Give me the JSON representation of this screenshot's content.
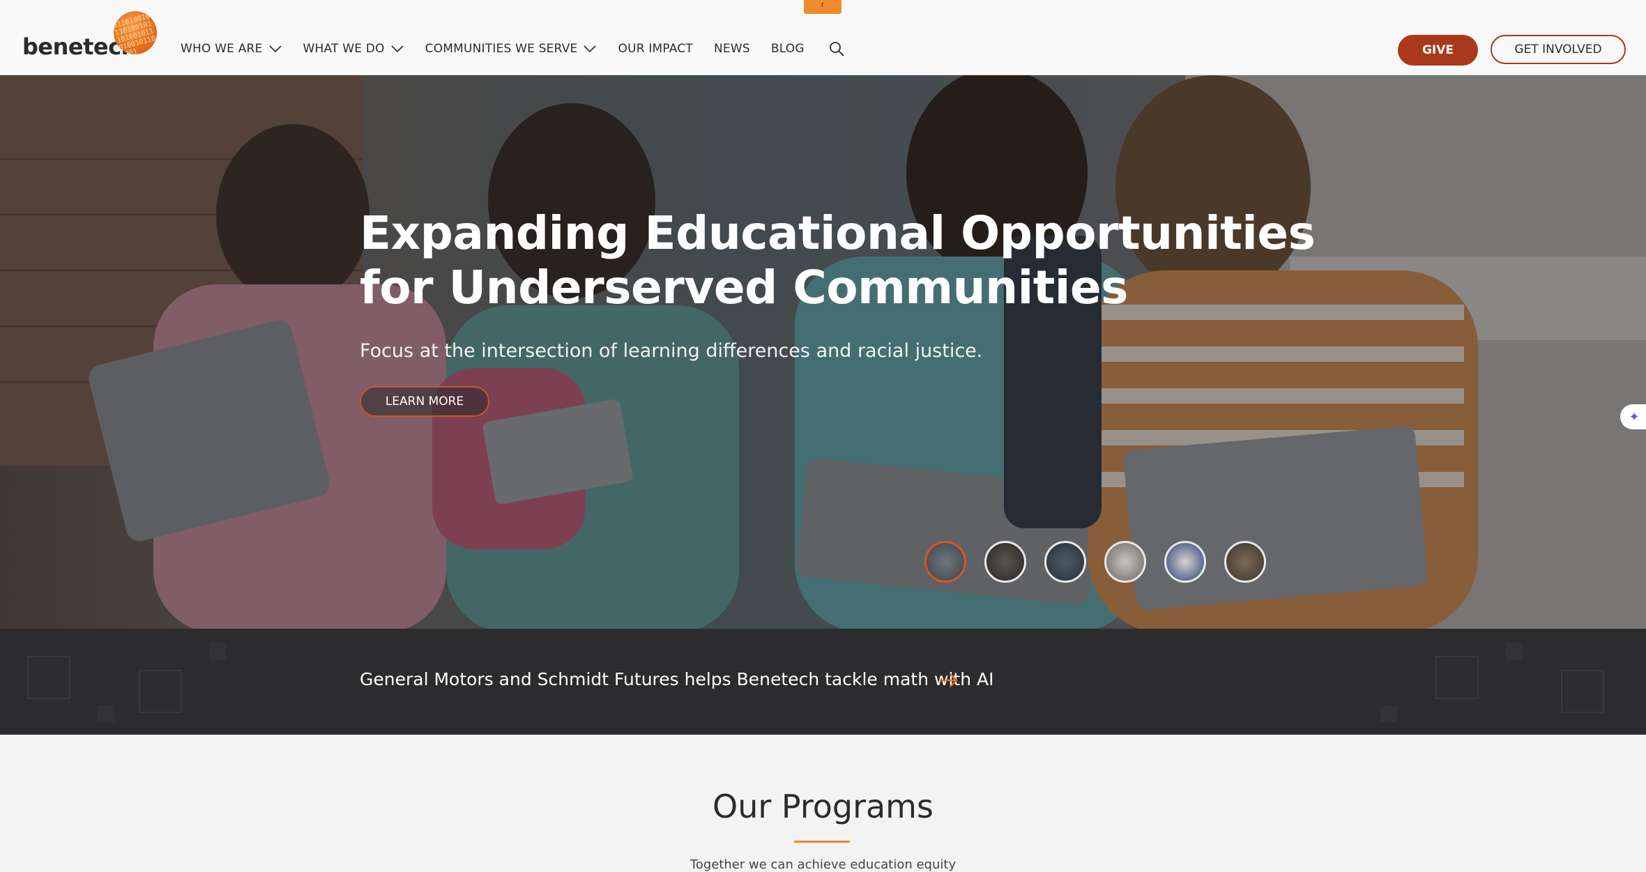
{
  "header": {
    "logo_text": "benetech",
    "logo_binary": "0110100101101001011010010110100101101001",
    "nav": [
      {
        "label": "WHO WE ARE",
        "has_dropdown": true
      },
      {
        "label": "WHAT WE DO",
        "has_dropdown": true
      },
      {
        "label": "COMMUNITIES WE SERVE",
        "has_dropdown": true
      },
      {
        "label": "OUR IMPACT",
        "has_dropdown": false
      },
      {
        "label": "NEWS",
        "has_dropdown": false
      },
      {
        "label": "BLOG",
        "has_dropdown": false
      }
    ],
    "orange_tab_label": "r",
    "give_label": "GIVE",
    "get_involved_label": "GET INVOLVED"
  },
  "hero": {
    "title": "Expanding Educational Opportunities for Underserved Communities",
    "subtitle": "Focus at the intersection of learning differences and racial justice.",
    "cta_label": "LEARN MORE",
    "slide_count": 6,
    "active_slide": 1
  },
  "banner": {
    "text": "General Motors and Schmidt Futures helps Benetech tackle math with AI"
  },
  "programs": {
    "title": "Our Programs",
    "subtitle": "Together we can achieve education equity"
  },
  "colors": {
    "brand_orange": "#e4701c",
    "give_button": "#a8391a",
    "banner_bg": "#2c2c2e",
    "accent_rule": "#e88a2e"
  }
}
